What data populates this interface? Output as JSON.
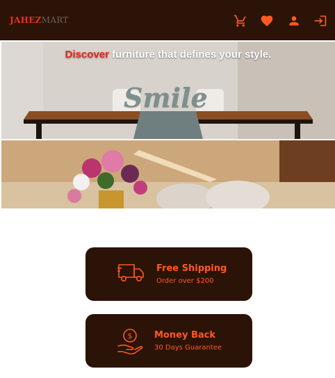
{
  "brand": {
    "part1": "JAHEZ",
    "part2": "MART"
  },
  "nav": {
    "icons": [
      "cart-icon",
      "heart-icon",
      "person-icon",
      "login-icon"
    ]
  },
  "hero": {
    "headline_accent": "Discover",
    "headline_rest": " furniture that defines your style.",
    "sign_text": "Smile"
  },
  "features": [
    {
      "title": "Free Shipping",
      "subtitle": "Order over $200",
      "icon": "truck-icon"
    },
    {
      "title": "Money Back",
      "subtitle": "30 Days Guarantee",
      "icon": "money-hand-icon"
    }
  ],
  "colors": {
    "navbar": "#2b1308",
    "accent": "#ff5a1f",
    "brand_red": "#e63219"
  }
}
